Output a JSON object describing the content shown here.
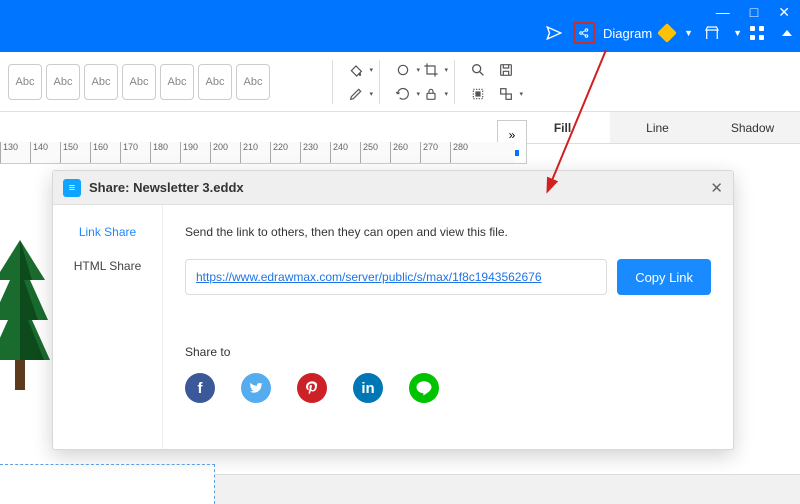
{
  "titlebar": {
    "diagram_label": "Diagram"
  },
  "toolbar": {
    "abc": "Abc"
  },
  "ruler_ticks": [
    "130",
    "140",
    "150",
    "160",
    "170",
    "180",
    "190",
    "200",
    "210",
    "220",
    "230",
    "240",
    "250",
    "260",
    "270",
    "280"
  ],
  "right_tabs": {
    "fill": "Fill",
    "line": "Line",
    "shadow": "Shadow"
  },
  "expand_glyph": "»",
  "modal": {
    "title": "Share: Newsletter 3.eddx",
    "side": {
      "link_share": "Link Share",
      "html_share": "HTML Share"
    },
    "instruction": "Send the link to others, then they can open and view this file.",
    "url": "https://www.edrawmax.com/server/public/s/max/1f8c1943562676",
    "copy_label": "Copy Link",
    "shareto_label": "Share to",
    "social": {
      "fb": "f",
      "tw": "",
      "pin": "",
      "li": "in",
      "line": ""
    }
  }
}
